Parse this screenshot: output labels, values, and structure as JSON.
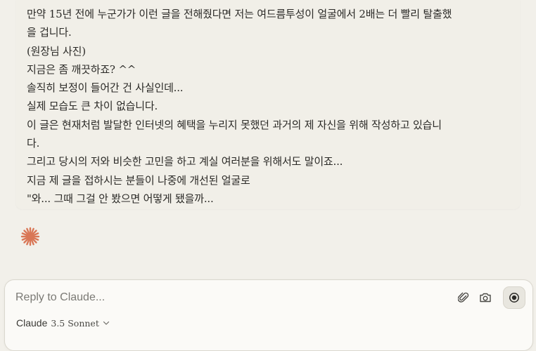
{
  "message": {
    "lines": [
      "만약 15년 전에 누군가가 이런 글을 전해줬다면 저는 여드름투성이 얼굴에서 2배는 더 빨리 탈출했",
      "을 겁니다.",
      "(원장님 사진)",
      "지금은 좀 깨끗하죠? ^^",
      "솔직히 보정이 들어간 건 사실인데...",
      "실제 모습도 큰 차이 없습니다.",
      "이 글은 현재처럼 발달한 인터넷의 혜택을 누리지 못했던 과거의 제 자신을 위해 작성하고 있습니",
      "다.",
      "그리고 당시의 저와 비슷한 고민을 하고 계실 여러분을 위해서도 말이죠...",
      "지금 제 글을 접하시는 분들이 나중에 개선된 얼굴로",
      "\"와... 그때 그걸 안 봤으면 어떻게 됐을까..."
    ]
  },
  "assistant_icon": "claude-spark-icon",
  "composer": {
    "placeholder": "Reply to Claude...",
    "attach_icon": "paperclip-icon",
    "camera_icon": "camera-icon",
    "record_icon": "record-icon",
    "model_name": "Claude",
    "model_version": "3.5 Sonnet",
    "model_chevron_icon": "chevron-down-icon"
  },
  "colors": {
    "background": "#f2f0ea",
    "message_background": "#f1efe8",
    "composer_background": "#fbfaf7",
    "claude_accent": "#d97757",
    "text": "#2b2a27"
  }
}
